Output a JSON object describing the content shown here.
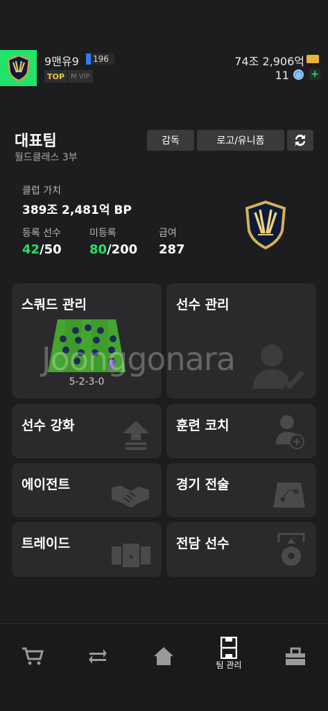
{
  "header": {
    "username": "9맨유9",
    "level": "196",
    "badge_top": "TOP",
    "badge_vip": "M VIP",
    "money": "74조 2,906억",
    "coins": "11"
  },
  "team": {
    "name": "대표팀",
    "league": "월드클래스 3부",
    "buttons": {
      "coach": "감독",
      "logo_uniform": "로고/유니폼"
    }
  },
  "stats": {
    "club_value_label": "클럽 가치",
    "club_value": "389조 2,481억 BP",
    "registered_label": "등록 선수",
    "registered_current": "42",
    "registered_max": "/50",
    "unregistered_label": "미등록",
    "unregistered_current": "80",
    "unregistered_max": "/200",
    "salary_label": "급여",
    "salary_value": "287"
  },
  "menu": {
    "squad": "스쿼드 관리",
    "formation": "5-2-3-0",
    "players": "선수 관리",
    "enhance": "선수 강화",
    "training": "훈련 코치",
    "agent": "에이전트",
    "tactics": "경기 전술",
    "trade": "트레이드",
    "dedicated": "전담 선수"
  },
  "watermark": "Joonggonara",
  "nav": {
    "active_label": "팀 관리",
    "items": [
      "shop-icon",
      "transfer-icon",
      "home-icon",
      "team-icon",
      "inventory-icon"
    ]
  },
  "colors": {
    "accent": "#20e36a",
    "gold": "#e7b43a",
    "card": "#2a2a2c"
  }
}
